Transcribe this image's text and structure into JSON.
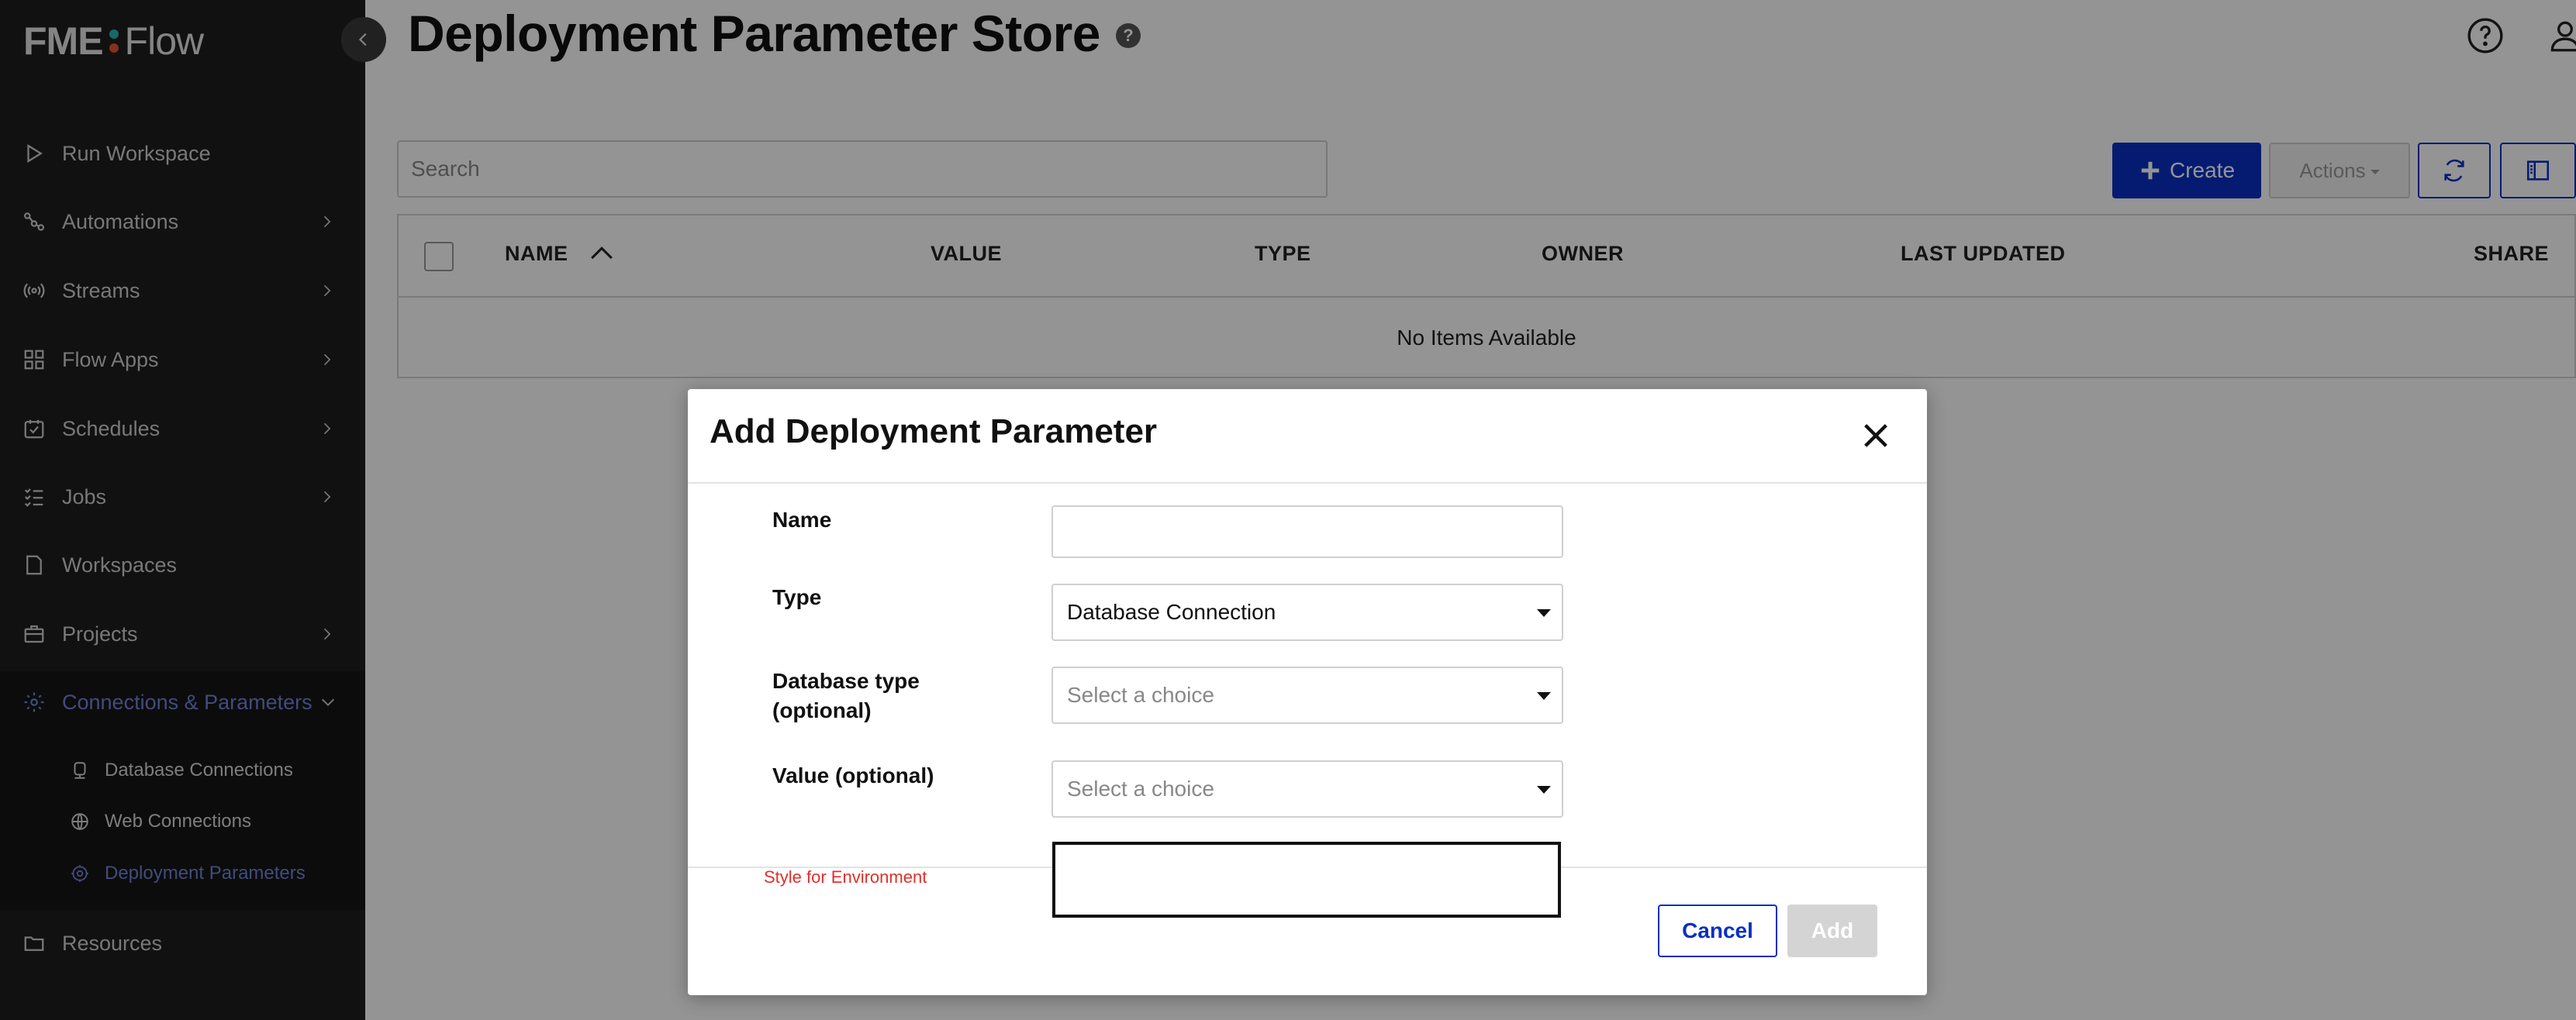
{
  "brand": {
    "fme": "FME",
    "flow": "Flow",
    "dot_colors": [
      "#2ab3b1",
      "#e4572e"
    ]
  },
  "sidebar": {
    "items": [
      {
        "label": "Run Workspace",
        "icon": "play-icon",
        "has_chevron": false
      },
      {
        "label": "Automations",
        "icon": "automations-icon",
        "has_chevron": true
      },
      {
        "label": "Streams",
        "icon": "broadcast-icon",
        "has_chevron": true
      },
      {
        "label": "Flow Apps",
        "icon": "apps-grid-icon",
        "has_chevron": true
      },
      {
        "label": "Schedules",
        "icon": "calendar-icon",
        "has_chevron": true
      },
      {
        "label": "Jobs",
        "icon": "checklist-icon",
        "has_chevron": true
      },
      {
        "label": "Workspaces",
        "icon": "file-icon",
        "has_chevron": false
      },
      {
        "label": "Projects",
        "icon": "briefcase-icon",
        "has_chevron": true
      },
      {
        "label": "Connections & Parameters",
        "icon": "gear-network-icon",
        "has_chevron": true,
        "expanded": true
      },
      {
        "label": "Resources",
        "icon": "folder-icon",
        "has_chevron": false
      }
    ],
    "sub_items": [
      {
        "label": "Database Connections",
        "icon": "database-icon"
      },
      {
        "label": "Web Connections",
        "icon": "globe-icon"
      },
      {
        "label": "Deployment Parameters",
        "icon": "gear-icon",
        "active": true
      }
    ],
    "active_color": "#6f83d6"
  },
  "header": {
    "title": "Deployment Parameter Store",
    "help_badge": "?"
  },
  "toolbar": {
    "search_placeholder": "Search",
    "create_label": "Create",
    "actions_label": "Actions"
  },
  "table": {
    "columns": [
      "NAME",
      "VALUE",
      "TYPE",
      "OWNER",
      "LAST UPDATED",
      "SHARE"
    ],
    "empty_message": "No Items Available"
  },
  "modal": {
    "title": "Add Deployment Parameter",
    "fields": {
      "name_label": "Name",
      "name_value": "",
      "type_label": "Type",
      "type_value": "Database Connection",
      "db_type_label_line1": "Database type",
      "db_type_label_line2": "(optional)",
      "db_type_placeholder": "Select a choice",
      "value_label": "Value (optional)",
      "value_placeholder": "Select a choice"
    },
    "style_label": "Style for Environment",
    "cancel_label": "Cancel",
    "add_label": "Add"
  },
  "colors": {
    "primary": "#0a2fc4",
    "sidebar_bg": "#1e1e1e",
    "error_text": "#e0302a"
  }
}
